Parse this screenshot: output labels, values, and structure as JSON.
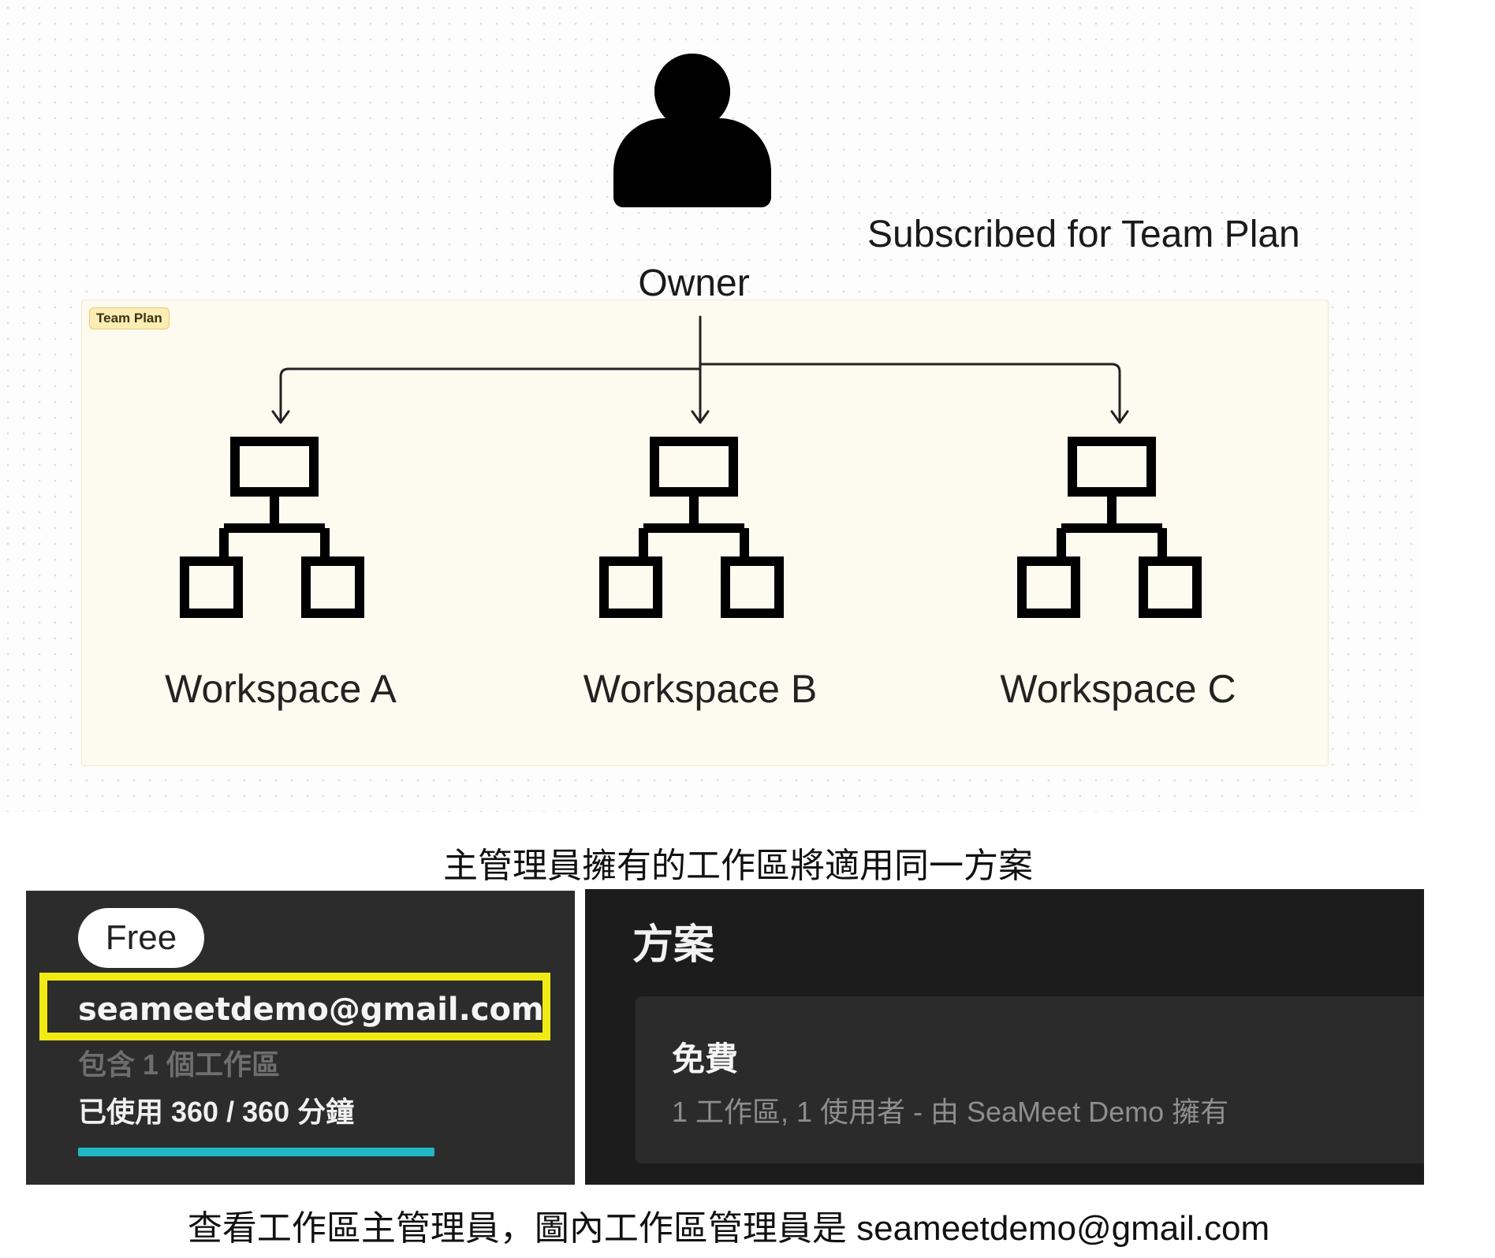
{
  "diagram": {
    "owner_label": "Owner",
    "subscription_text": "Subscribed for Team Plan",
    "plan_tag": "Team Plan",
    "workspaces": [
      {
        "label": "Workspace A"
      },
      {
        "label": "Workspace B"
      },
      {
        "label": "Workspace C"
      }
    ]
  },
  "captions": {
    "top": "主管理員擁有的工作區將適用同一方案",
    "bottom": "查看工作區主管理員，圖內工作區管理員是 seameetdemo@gmail.com"
  },
  "account_panel": {
    "plan_badge": "Free",
    "email": "seameetdemo@gmail.com",
    "workspace_count": "包含 1 個工作區",
    "usage": "已使用 360 / 360 分鐘",
    "usage_fraction": 1.0,
    "progress_color": "#21b7c4",
    "highlight_color": "#f2ea14"
  },
  "plan_panel": {
    "title": "方案",
    "plan_name": "免費",
    "plan_description": "1 工作區, 1 使用者 - 由 SeaMeet Demo 擁有"
  }
}
